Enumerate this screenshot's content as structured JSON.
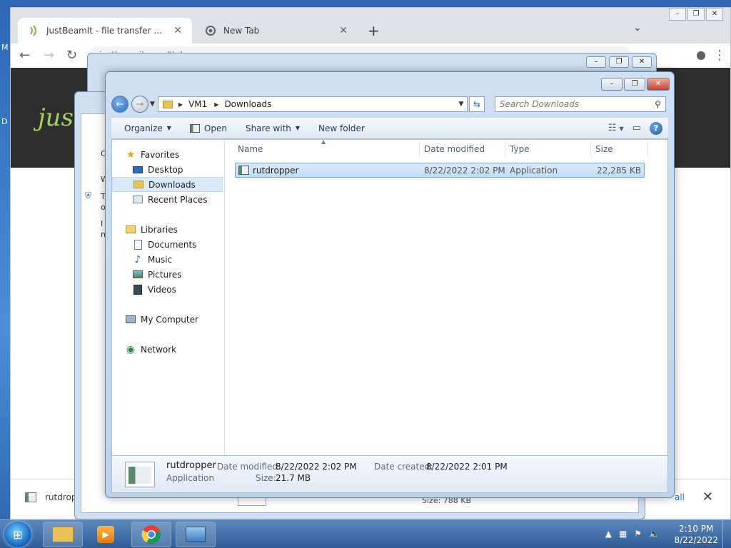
{
  "chrome": {
    "tab_active_title": "JustBeamIt - file transfer made e",
    "tab_second_title": "New Tab",
    "omnibox": "justbeamit.com/tkdy",
    "logo_text": "just",
    "download_file": "rutdrop",
    "show_all": "all"
  },
  "background_window": {
    "size_label": "Size: 788 KB",
    "frag_c": "C",
    "frag_w": "W",
    "frag_t": "T",
    "frag_o": "o",
    "frag_i": "I",
    "frag_n": "n"
  },
  "desktop": {
    "frag_m": "M",
    "frag_d": "D"
  },
  "explorer": {
    "address": {
      "crumbs": [
        "VM1",
        "Downloads"
      ]
    },
    "search_placeholder": "Search Downloads",
    "commands": {
      "organize": "Organize",
      "open": "Open",
      "share_with": "Share with",
      "new_folder": "New folder"
    },
    "nav": {
      "favorites": "Favorites",
      "desktop": "Desktop",
      "downloads": "Downloads",
      "recent_places": "Recent Places",
      "libraries": "Libraries",
      "documents": "Documents",
      "music": "Music",
      "pictures": "Pictures",
      "videos": "Videos",
      "my_computer": "My Computer",
      "network": "Network"
    },
    "columns": {
      "name": "Name",
      "date_modified": "Date modified",
      "type": "Type",
      "size": "Size"
    },
    "files": [
      {
        "name": "rutdropper",
        "date_modified": "8/22/2022 2:02 PM",
        "type": "Application",
        "size": "22,285 KB"
      }
    ],
    "details": {
      "name": "rutdropper",
      "kind": "Application",
      "date_modified_label": "Date modified:",
      "date_modified": "8/22/2022 2:02 PM",
      "size_label": "Size:",
      "size": "21.7 MB",
      "date_created_label": "Date created:",
      "date_created": "8/22/2022 2:01 PM"
    }
  },
  "taskbar": {
    "time": "2:10 PM",
    "date": "8/22/2022"
  },
  "colors": {
    "accent": "#2c6bc0",
    "selection": "#c1dcf8",
    "logo": "#a6d25a"
  }
}
